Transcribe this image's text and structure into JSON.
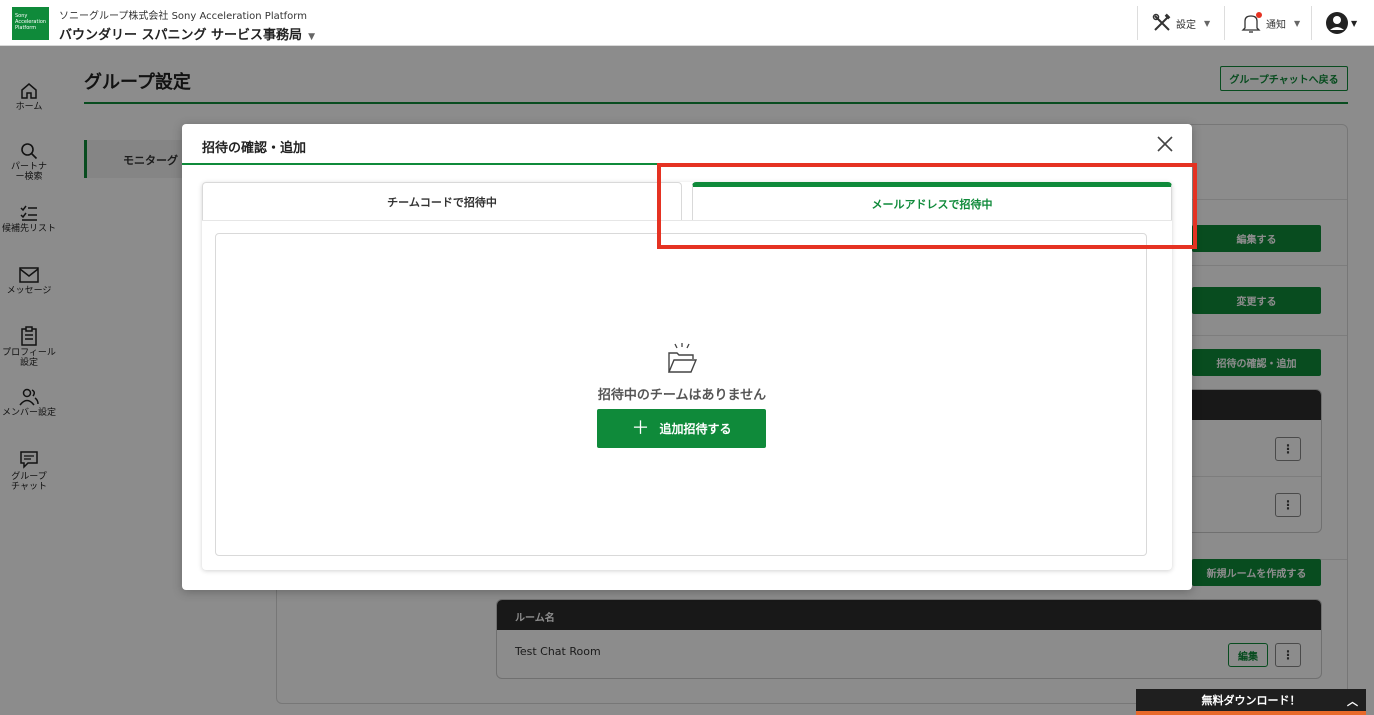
{
  "header": {
    "logo_lines": [
      "Sony",
      "Acceleration",
      "Platform"
    ],
    "company": "ソニーグループ株式会社 Sony Acceleration Platform",
    "office": "バウンダリー スパニング サービス事務局",
    "settings_label": "設定",
    "notifications_label": "通知"
  },
  "nav": [
    {
      "label": "ホーム",
      "icon": "home-icon"
    },
    {
      "label": "パートナー検索",
      "icon": "search-icon"
    },
    {
      "label": "候補先リスト",
      "icon": "checklist-icon"
    },
    {
      "label": "メッセージ",
      "icon": "mail-icon"
    },
    {
      "label": "プロフィール設定",
      "icon": "profile-icon"
    },
    {
      "label": "メンバー設定",
      "icon": "members-icon"
    },
    {
      "label": "グループチャット",
      "icon": "chat-icon"
    }
  ],
  "page": {
    "title": "グループ設定",
    "back_button": "グループチャットへ戻る",
    "side_tab": "モニターグ",
    "buttons": {
      "edit": "編集する",
      "change": "変更する",
      "invite": "招待の確認・追加",
      "new_room": "新規ルームを作成する"
    },
    "room_table": {
      "header": "ルーム名",
      "rows": [
        {
          "name": "Test Chat Room",
          "edit": "編集"
        }
      ]
    }
  },
  "modal": {
    "title": "招待の確認・追加",
    "tabs": [
      {
        "label": "チームコードで招待中",
        "active": false
      },
      {
        "label": "メールアドレスで招待中",
        "active": true
      }
    ],
    "empty_message": "招待中のチームはありません",
    "add_button": "追加招待する"
  },
  "download_bar": {
    "label": "無料ダウンロード！"
  },
  "colors": {
    "brand_green": "#0f8a3a",
    "highlight_red": "#e53222",
    "overlay": "rgba(0,0,0,0.45)"
  }
}
